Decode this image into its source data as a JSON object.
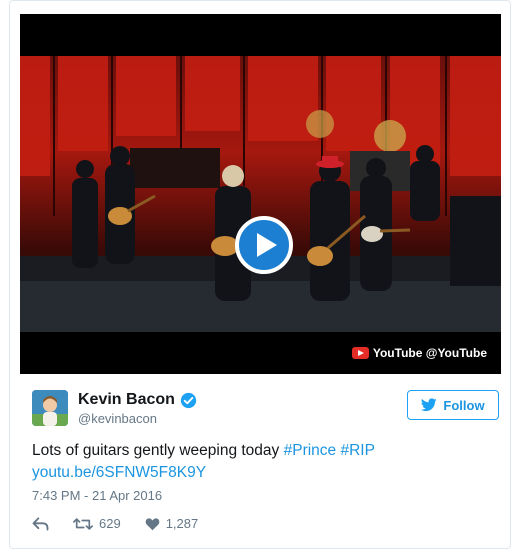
{
  "video": {
    "attribution": "YouTube @YouTube",
    "icons": {
      "play": "play-icon",
      "youtube": "youtube-logo-icon"
    }
  },
  "tweet": {
    "author_name": "Kevin Bacon",
    "author_handle": "@kevinbacon",
    "verified": true,
    "follow_label": "Follow",
    "text_plain": "Lots of guitars gently weeping today",
    "hashtags": [
      "#Prince",
      "#RIP"
    ],
    "link": "youtu.be/6SFNW5F8K9Y",
    "timestamp": "7:43 PM - 21 Apr 2016",
    "retweet_count": "629",
    "like_count": "1,287"
  },
  "colors": {
    "link": "#1b95e0",
    "verified": "#1da1f2",
    "muted": "#657786",
    "play_button": "#1d7fd1",
    "youtube_red": "#e52d27"
  }
}
